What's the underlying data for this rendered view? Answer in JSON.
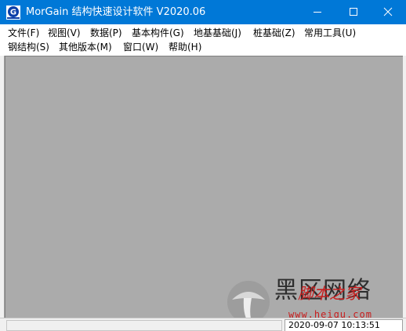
{
  "window": {
    "title": "MorGain 结构快速设计软件 V2020.06",
    "titlebar_color": "#0078d7"
  },
  "menu": {
    "row1": [
      {
        "label": "文件(F)"
      },
      {
        "label": "视图(V)"
      },
      {
        "label": "数据(P)"
      },
      {
        "label": "基本构件(G)"
      },
      {
        "label": "地基基础(J)"
      },
      {
        "label": "桩基础(Z)"
      },
      {
        "label": "常用工具(U)"
      }
    ],
    "row2": [
      {
        "label": "钢结构(S)"
      },
      {
        "label": "其他版本(M)"
      },
      {
        "label": "窗口(W)"
      },
      {
        "label": "帮助(H)"
      }
    ]
  },
  "client": {
    "background": "#ababab"
  },
  "statusbar": {
    "datetime": "2020-09-07 10:13:51"
  },
  "watermark": {
    "title": "黑区网络",
    "subtitle": "脚本之家",
    "url": "www.heiqu.com"
  }
}
